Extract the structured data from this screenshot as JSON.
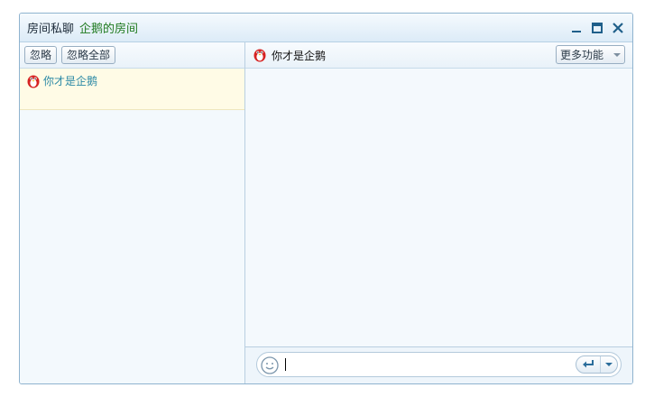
{
  "window": {
    "title": "房间私聊",
    "room_name": "企鹅的房间"
  },
  "left": {
    "ignore_label": "忽略",
    "ignore_all_label": "忽略全部",
    "contacts": [
      {
        "name": "你才是企鹅"
      }
    ]
  },
  "right": {
    "chat_title": "你才是企鹅",
    "more_label": "更多功能"
  },
  "input": {
    "value": ""
  },
  "icons": {
    "minimize": "minimize-icon",
    "maximize": "maximize-icon",
    "close": "close-icon",
    "avatar": "penguin-icon",
    "emoji": "emoji-icon",
    "send": "send-arrow-icon",
    "dropdown": "chevron-down-icon"
  },
  "colors": {
    "accent_blue": "#1f5f8a",
    "room_name_green": "#1f7a1f",
    "contact_highlight": "#fffbe6",
    "avatar_red": "#d62222"
  }
}
